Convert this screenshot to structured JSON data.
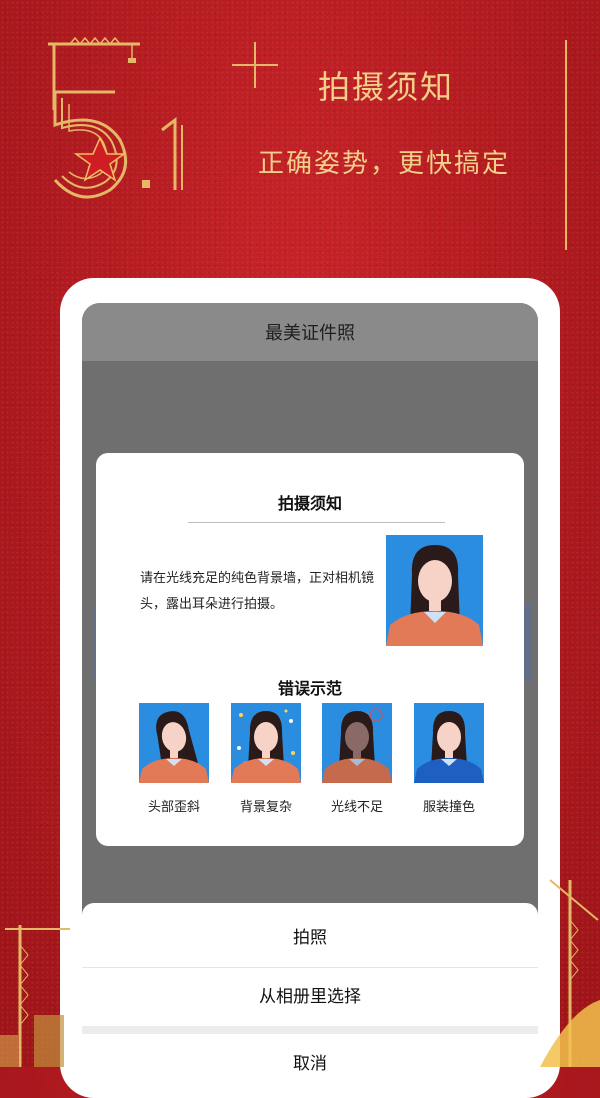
{
  "header": {
    "big_number": "5.1",
    "title": "拍摄须知",
    "subtitle": "正确姿势，更快搞定"
  },
  "app": {
    "title": "最美证件照"
  },
  "dialog": {
    "title": "拍摄须知",
    "instruction": "请在光线充足的纯色背景墙，正对相机镜头，露出耳朵进行拍摄。",
    "wrong_title": "错误示范",
    "wrong_examples": [
      {
        "label": "头部歪斜",
        "bg": "#2b8de0",
        "shirt": "#e27a58"
      },
      {
        "label": "背景复杂",
        "bg": "#2b8de0",
        "shirt": "#e27a58"
      },
      {
        "label": "光线不足",
        "bg": "#2b8de0",
        "shirt": "#e27a58"
      },
      {
        "label": "服装撞色",
        "bg": "#2b8de0",
        "shirt": "#1e5fc2"
      }
    ]
  },
  "sheet": {
    "shoot": "拍照",
    "album": "从相册里选择",
    "cancel": "取消"
  },
  "colors": {
    "background": "#b51c22",
    "gold": "#f2d08a",
    "photo_bg": "#2b8de0"
  }
}
